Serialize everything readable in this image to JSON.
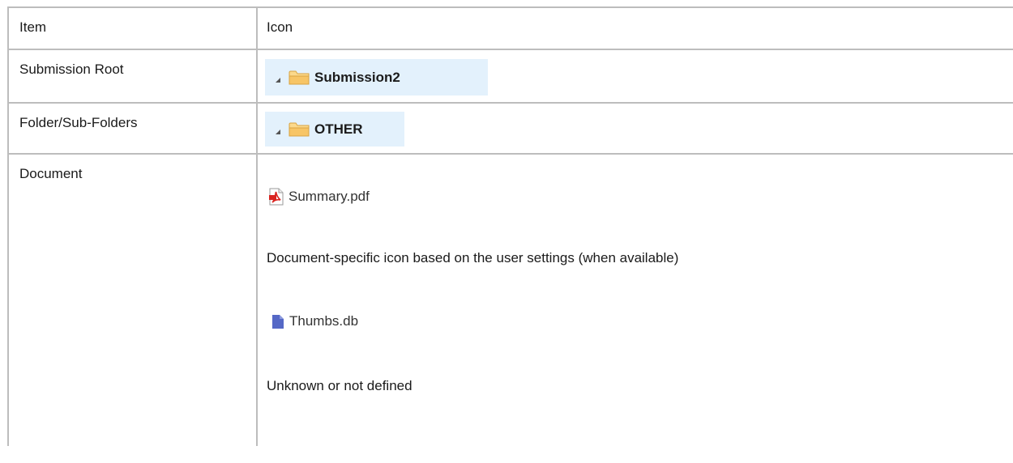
{
  "header": {
    "item_label": "Item",
    "icon_label": "Icon"
  },
  "rows": [
    {
      "item": "Submission Root",
      "node": {
        "label": "Submission2",
        "icon": "folder-icon",
        "expander": "expanded-triangle-icon"
      }
    },
    {
      "item": "Folder/Sub-Folders",
      "node": {
        "label": "OTHER",
        "icon": "folder-icon",
        "expander": "expanded-triangle-icon"
      }
    },
    {
      "item": "Document",
      "entries": [
        {
          "file": "Summary.pdf",
          "icon": "pdf-icon",
          "caption": "Document-specific icon based on the user settings (when available)"
        },
        {
          "file": "Thumbs.db",
          "icon": "generic-file-icon",
          "caption": "Unknown or not defined"
        }
      ]
    }
  ],
  "colors": {
    "border": "#bdbdbd",
    "node_bg": "#e3f1fc",
    "folder_fill": "#f7c566",
    "pdf_red": "#d9231f",
    "generic_file_blue": "#5568c6"
  }
}
